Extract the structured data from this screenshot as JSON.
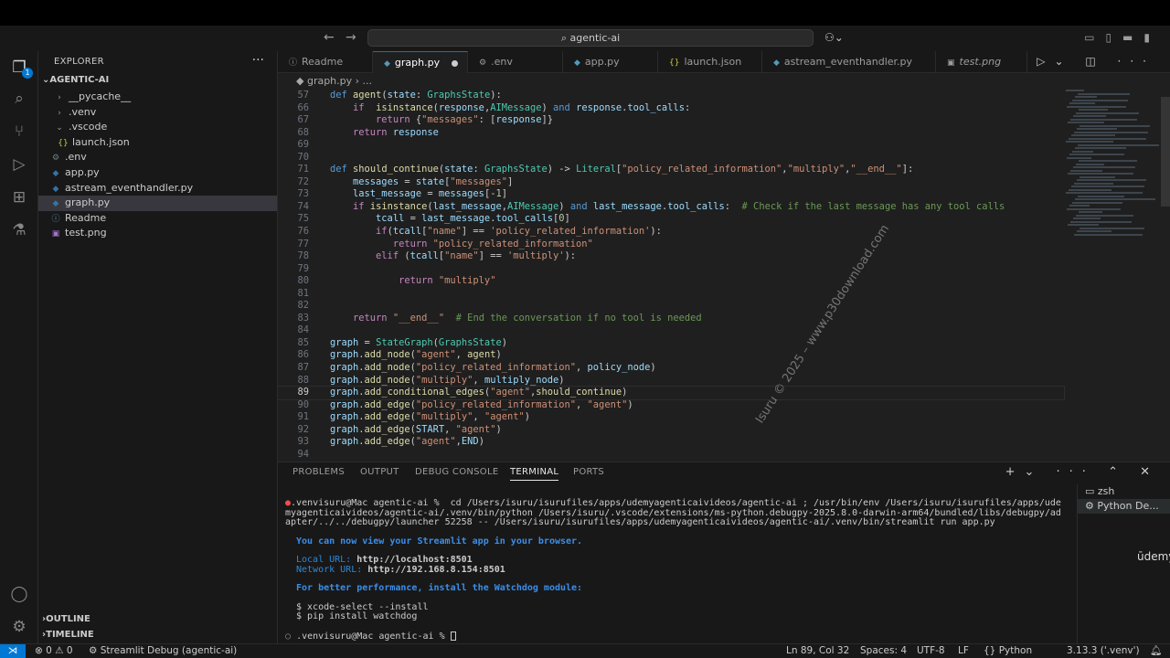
{
  "titlebar": {
    "search": "agentic-ai",
    "back": "←",
    "forward": "→"
  },
  "activity": {
    "explorer_badge": "1"
  },
  "sidebar": {
    "title": "EXPLORER",
    "more": "···",
    "root": "AGENTIC-AI",
    "items": [
      {
        "label": "__pycache__",
        "icon": "›",
        "icolor": "#9d9d9d",
        "indent": 16
      },
      {
        "label": ".venv",
        "icon": "›",
        "icolor": "#9d9d9d",
        "indent": 16
      },
      {
        "label": ".vscode",
        "icon": "⌄",
        "icolor": "#9d9d9d",
        "indent": 16
      },
      {
        "label": "launch.json",
        "icon": "{}",
        "icolor": "#cbcb41",
        "indent": 20
      },
      {
        "label": ".env",
        "icon": "⚙",
        "icolor": "#6d8086",
        "indent": 12
      },
      {
        "label": "app.py",
        "icon": "◆",
        "icolor": "#3572a5",
        "indent": 12
      },
      {
        "label": "astream_eventhandler.py",
        "icon": "◆",
        "icolor": "#3572a5",
        "indent": 12
      },
      {
        "label": "graph.py",
        "icon": "◆",
        "icolor": "#3572a5",
        "indent": 12,
        "selected": true
      },
      {
        "label": "Readme",
        "icon": "ⓘ",
        "icolor": "#519aba",
        "indent": 12
      },
      {
        "label": "test.png",
        "icon": "▣",
        "icolor": "#a074c4",
        "indent": 12
      }
    ],
    "outline": "OUTLINE",
    "timeline": "TIMELINE"
  },
  "tabs": [
    {
      "label": "Readme",
      "icon": "ⓘ"
    },
    {
      "label": "graph.py",
      "icon": "◆",
      "active": true,
      "dirty": true
    },
    {
      "label": ".env",
      "icon": "⚙"
    },
    {
      "label": "app.py",
      "icon": "◆"
    },
    {
      "label": "launch.json",
      "icon": "{}"
    },
    {
      "label": "astream_eventhandler.py",
      "icon": "◆"
    },
    {
      "label": "test.png",
      "icon": "▣"
    }
  ],
  "breadcrumb": "◆ graph.py › ...",
  "editor": {
    "current_line": 89,
    "watermark": "Isuru © 2025 – www.p30download.com"
  },
  "panel": {
    "tabs": [
      "PROBLEMS",
      "OUTPUT",
      "DEBUG CONSOLE",
      "TERMINAL",
      "PORTS"
    ],
    "active_tab": "TERMINAL",
    "terminal": {
      "prompt": ".venvisuru@Mac agentic-ai % ",
      "command": " cd /Users/isuru/isurufiles/apps/udemyagenticaivideos/agentic-ai ; /usr/bin/env /Users/isuru/isurufiles/apps/udemyagenticaivideos/agentic-ai/.venv/bin/python /Users/isuru/.vscode/extensions/ms-python.debugpy-2025.8.0-darwin-arm64/bundled/libs/debugpy/adapter/../../debugpy/launcher 52258 -- /Users/isuru/isurufiles/apps/udemyagenticaivideos/agentic-ai/.venv/bin/streamlit run app.py",
      "view_msg": "You can now view your Streamlit app in your browser.",
      "local_label": "Local URL:",
      "local_url": "http://localhost:8501",
      "network_label": "Network URL:",
      "network_url": "http://192.168.8.154:8501",
      "perf_msg": "For better performance, install the Watchdog module:",
      "cmd1": "$ xcode-select --install",
      "cmd2": "$ pip install watchdog",
      "prompt2": ".venvisuru@Mac agentic-ai % "
    },
    "terminals": [
      "zsh",
      "Python De..."
    ],
    "udemy": "ūdemy"
  },
  "status": {
    "problems": "⊗ 0 ⚠ 0",
    "ports": "0",
    "debug": "Streamlit Debug (agentic-ai)",
    "position": "Ln 89, Col 32",
    "spaces": "Spaces: 4",
    "encoding": "UTF-8",
    "eol": "LF",
    "language": "Python",
    "interpreter": "3.13.3 ('.venv')"
  },
  "colors": {
    "accent": "#0078d4",
    "editor_bg": "#1f1f1f",
    "sidebar_bg": "#181818"
  }
}
